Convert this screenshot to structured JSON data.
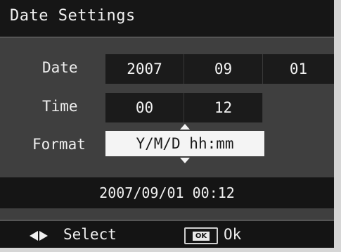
{
  "title": "Date Settings",
  "date": {
    "label": "Date",
    "year": "2007",
    "month": "09",
    "day": "01"
  },
  "time": {
    "label": "Time",
    "hour": "00",
    "minute": "12"
  },
  "format": {
    "label": "Format",
    "value": "Y/M/D hh:mm"
  },
  "preview": "2007/09/01 00:12",
  "footer": {
    "select_icon": "left-right-arrows-icon",
    "select_label": "Select",
    "ok_key": "OK",
    "ok_label": "Ok"
  },
  "colors": {
    "background": "#3f3f3f",
    "field_background": "#1b1b1b",
    "highlight_background": "#f4f4f4",
    "text": "#f0f0f0"
  }
}
